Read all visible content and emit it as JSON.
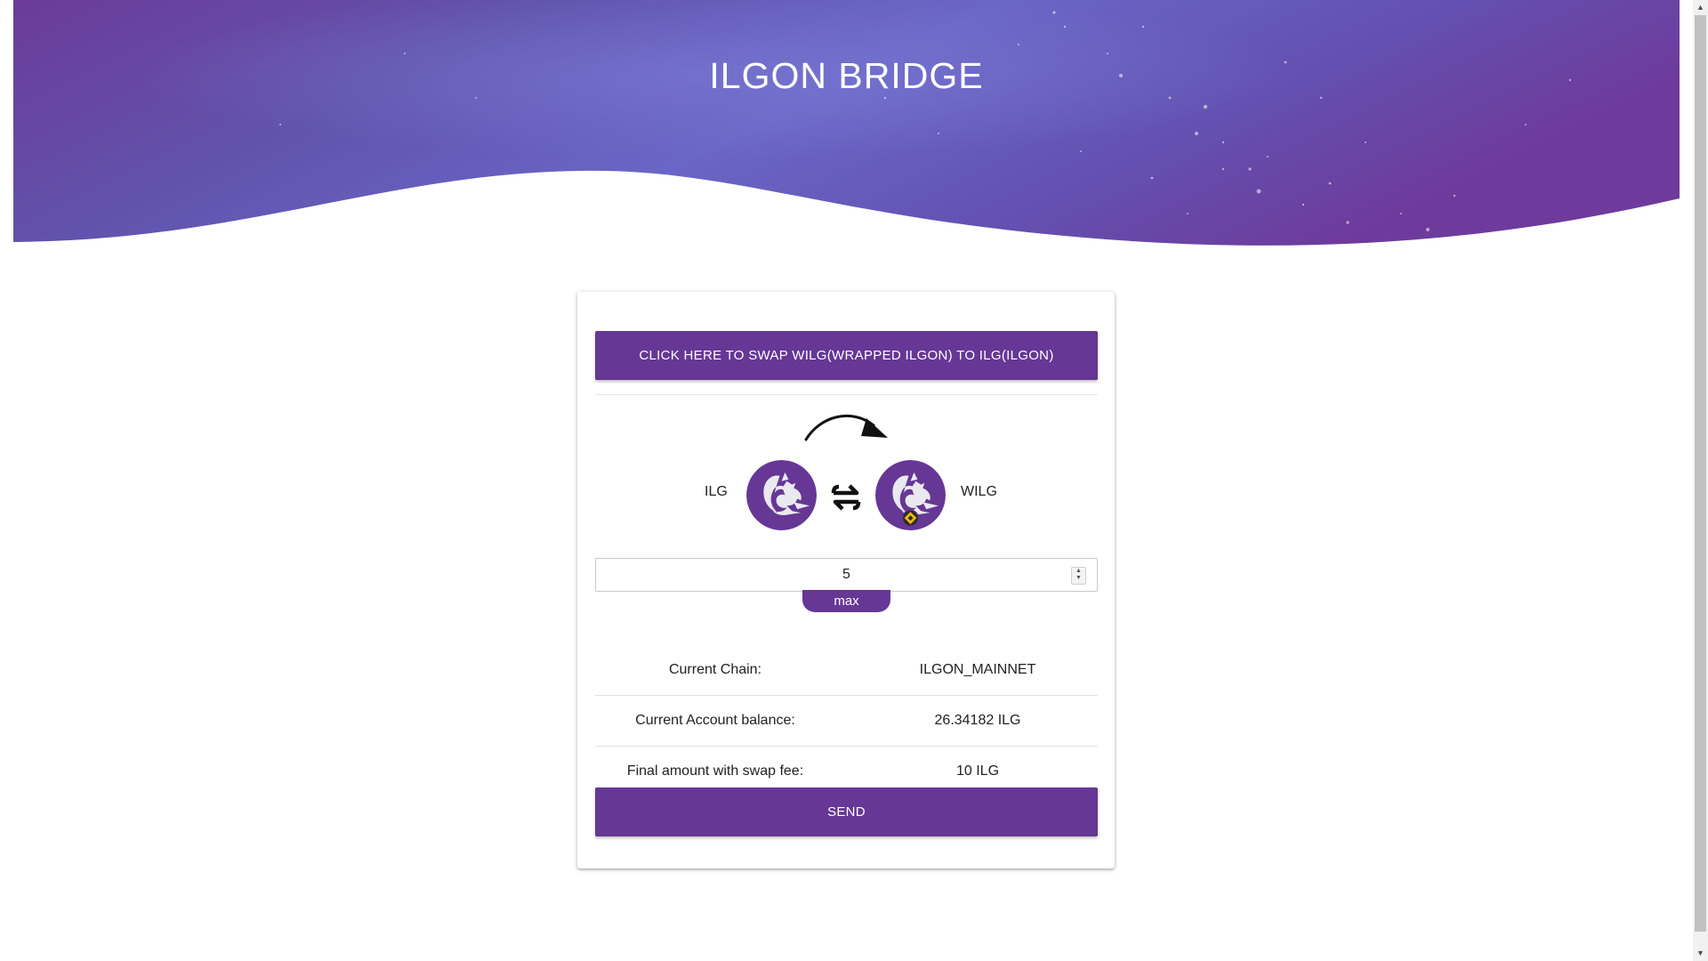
{
  "header": {
    "title": "ILGON BRIDGE"
  },
  "swap_direction_button": {
    "label": "CLICK HERE TO SWAP WILG(WRAPPED ILGON) TO ILG(ILGON)"
  },
  "swap": {
    "from_token": "ILG",
    "to_token": "WILG",
    "icons": {
      "arrow": "curved-arrow-right-icon",
      "swap": "swap-arrows-icon",
      "from_logo": "ilgon-dragon-logo",
      "to_logo": "wilg-dragon-logo-with-bnb-badge"
    }
  },
  "amount": {
    "value": "5",
    "max_label": "max"
  },
  "info": [
    {
      "key": "Current Chain:",
      "value": "ILGON_MAINNET"
    },
    {
      "key": "Current Account balance:",
      "value": "26.34182 ILG"
    },
    {
      "key": "Final amount with swap fee:",
      "value": "10 ILG"
    }
  ],
  "send_button": {
    "label": "SEND"
  },
  "colors": {
    "brand_purple": "#663795",
    "header_dark": "#6a3f9c",
    "header_light": "#6b67c9"
  }
}
